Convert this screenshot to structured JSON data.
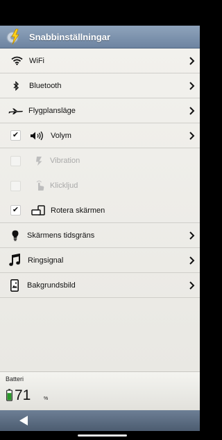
{
  "header": {
    "title": "Snabbinställningar",
    "app_icon": "lightning-gear-icon"
  },
  "menu": [
    {
      "label": "WiFi",
      "icon": "wifi-icon"
    },
    {
      "label": "Bluetooth",
      "icon": "bluetooth-icon"
    },
    {
      "label": "Flygplansläge",
      "icon": "airplane-icon"
    },
    {
      "label": "Volym",
      "icon": "speaker-icon",
      "checked": true
    },
    {
      "label": "Vibration",
      "icon": "vibration-icon",
      "checked": false,
      "disabled": true
    },
    {
      "label": "Klickljud",
      "icon": "touch-icon",
      "checked": false,
      "disabled": true
    },
    {
      "label": "Rotera skärmen",
      "icon": "rotate-screen-icon",
      "checked": true
    },
    {
      "label": "Skärmens tidsgräns",
      "icon": "lightbulb-icon"
    },
    {
      "label": "Ringsignal",
      "icon": "music-note-icon"
    },
    {
      "label": "Bakgrundsbild",
      "icon": "wallpaper-icon"
    }
  ],
  "battery": {
    "label": "Batteri",
    "value": "71",
    "unit": "%",
    "level": 0.71,
    "color": "#2a9a2a"
  },
  "checkmark": "✔",
  "colors": {
    "header": "#7b8fab",
    "navbar": "#5a6a7e",
    "disabled_text": "#a9a9a9"
  }
}
